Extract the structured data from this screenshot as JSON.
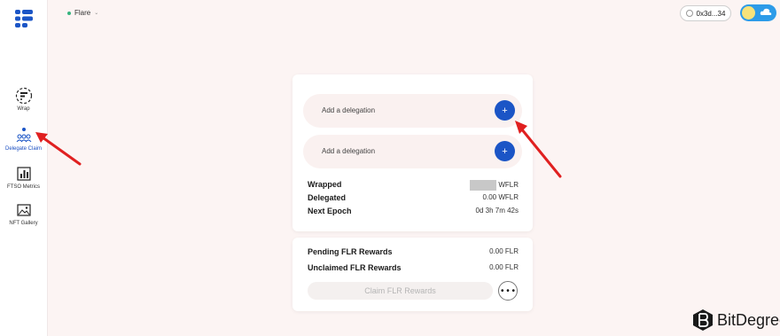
{
  "header": {
    "network": "Flare",
    "wallet_address": "0x3d...34"
  },
  "sidebar": {
    "items": [
      {
        "label": "Wrap",
        "icon": "wrap-icon"
      },
      {
        "label": "Delegate Claim",
        "icon": "delegate-icon"
      },
      {
        "label": "FTSO Metrics",
        "icon": "metrics-icon"
      },
      {
        "label": "NFT Gallery",
        "icon": "gallery-icon"
      }
    ]
  },
  "delegations": [
    {
      "label": "Add a delegation",
      "button": "+"
    },
    {
      "label": "Add a delegation",
      "button": "+"
    }
  ],
  "balances": {
    "wrapped_label": "Wrapped",
    "wrapped_unit": "WFLR",
    "delegated_label": "Delegated",
    "delegated_value": "0.00 WFLR",
    "epoch_label": "Next Epoch",
    "epoch_value": "0d 3h 7m 42s"
  },
  "rewards": {
    "pending_label": "Pending FLR Rewards",
    "pending_value": "0.00 FLR",
    "unclaimed_label": "Unclaimed FLR Rewards",
    "unclaimed_value": "0.00 FLR",
    "claim_label": "Claim FLR Rewards",
    "more_label": "• • •"
  },
  "branding": {
    "name": "BitDegree"
  },
  "colors": {
    "accent": "#1b55c6",
    "annotation": "#e02020",
    "background": "#fcf4f3"
  }
}
